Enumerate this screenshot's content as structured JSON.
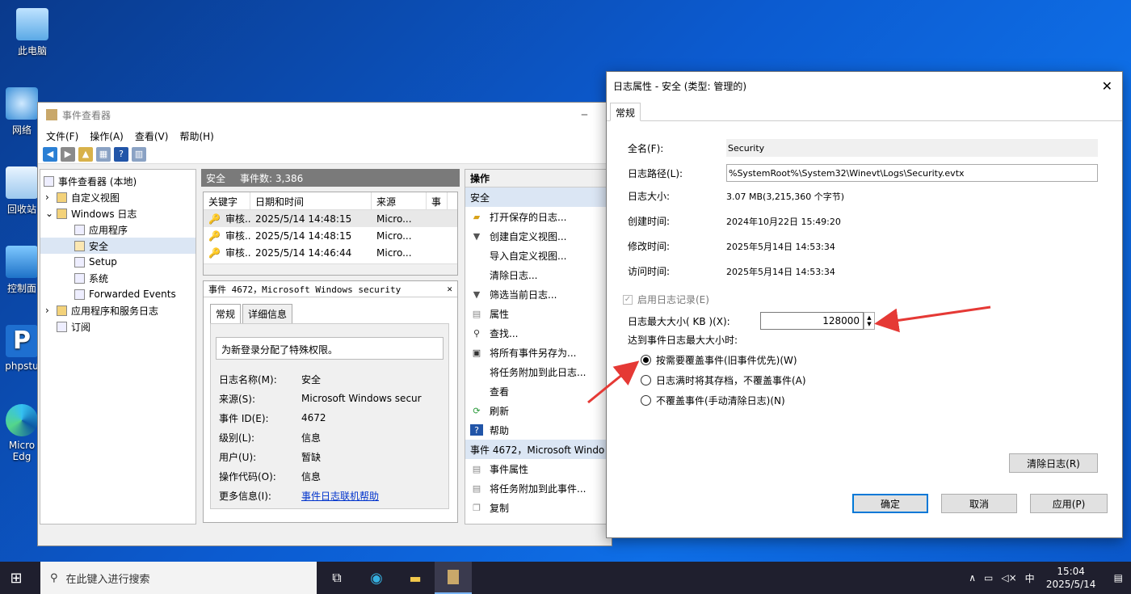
{
  "desktop": {
    "icons": [
      {
        "label": "此电脑"
      },
      {
        "label": "网络"
      },
      {
        "label": "回收站"
      },
      {
        "label": "控制面"
      },
      {
        "label": "phpstu"
      },
      {
        "label": "Micro Edg"
      }
    ]
  },
  "event_viewer": {
    "title": "事件查看器",
    "menu": [
      "文件(F)",
      "操作(A)",
      "查看(V)",
      "帮助(H)"
    ],
    "tree": [
      {
        "label": "事件查看器 (本地)"
      },
      {
        "label": "自定义视图"
      },
      {
        "label": "Windows 日志"
      },
      {
        "label": "应用程序"
      },
      {
        "label": "安全"
      },
      {
        "label": "Setup"
      },
      {
        "label": "系统"
      },
      {
        "label": "Forwarded Events"
      },
      {
        "label": "应用程序和服务日志"
      },
      {
        "label": "订阅"
      }
    ],
    "pane_title": "安全",
    "event_count": "事件数: 3,386",
    "columns": [
      "关键字",
      "日期和时间",
      "来源",
      "事"
    ],
    "rows": [
      {
        "kw": "审核...",
        "date": "2025/5/14 14:48:15",
        "src": "Micro..."
      },
      {
        "kw": "审核...",
        "date": "2025/5/14 14:48:15",
        "src": "Micro..."
      },
      {
        "kw": "审核...",
        "date": "2025/5/14 14:46:44",
        "src": "Micro..."
      }
    ],
    "detail_title": "事件 4672，Microsoft Windows security",
    "detail_tabs": [
      "常规",
      "详细信息"
    ],
    "detail_message": "为新登录分配了特殊权限。",
    "detail_fields": [
      {
        "k": "日志名称(M):",
        "v": "安全"
      },
      {
        "k": "来源(S):",
        "v": "Microsoft Windows secur"
      },
      {
        "k": "事件 ID(E):",
        "v": "4672"
      },
      {
        "k": "级别(L):",
        "v": "信息"
      },
      {
        "k": "用户(U):",
        "v": "暂缺"
      },
      {
        "k": "操作代码(O):",
        "v": "信息"
      },
      {
        "k": "更多信息(I):",
        "v": "事件日志联机帮助"
      }
    ],
    "actions_title": "操作",
    "actions_section1": "安全",
    "actions": [
      "打开保存的日志...",
      "创建自定义视图...",
      "导入自定义视图...",
      "清除日志...",
      "筛选当前日志...",
      "属性",
      "查找...",
      "将所有事件另存为...",
      "将任务附加到此日志...",
      "查看",
      "刷新",
      "帮助"
    ],
    "actions_section2": "事件 4672，Microsoft Windo",
    "actions2": [
      "事件属性",
      "将任务附加到此事件...",
      "复制"
    ]
  },
  "dialog": {
    "title": "日志属性 - 安全 (类型: 管理的)",
    "tab": "常规",
    "fields": [
      {
        "k": "全名(F):",
        "v": "Security"
      },
      {
        "k": "日志路径(L):",
        "v": "%SystemRoot%\\System32\\Winevt\\Logs\\Security.evtx"
      },
      {
        "k": "日志大小:",
        "v": "3.07 MB(3,215,360 个字节)"
      },
      {
        "k": "创建时间:",
        "v": "2024年10月22日 15:49:20"
      },
      {
        "k": "修改时间:",
        "v": "2025年5月14日 14:53:34"
      },
      {
        "k": "访问时间:",
        "v": "2025年5月14日 14:53:34"
      }
    ],
    "enable_log": "启用日志记录(E)",
    "max_size_label": "日志最大大小( KB )(X):",
    "max_size_value": "128000",
    "when_max_label": "达到事件日志最大大小时:",
    "radios": [
      "按需要覆盖事件(旧事件优先)(W)",
      "日志满时将其存档，不覆盖事件(A)",
      "不覆盖事件(手动清除日志)(N)"
    ],
    "clear_button": "清除日志(R)",
    "ok": "确定",
    "cancel": "取消",
    "apply": "应用(P)"
  },
  "taskbar": {
    "search_placeholder": "在此键入进行搜索",
    "ime": "中",
    "time": "15:04",
    "date": "2025/5/14"
  },
  "colors": {
    "accent": "#0078d7",
    "arrow": "#e53935"
  }
}
